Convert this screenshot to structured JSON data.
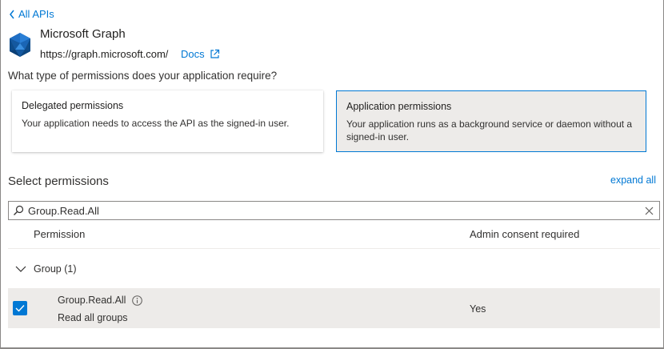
{
  "nav": {
    "back_label": "All APIs"
  },
  "api": {
    "name": "Microsoft Graph",
    "url": "https://graph.microsoft.com/",
    "docs_label": "Docs",
    "logo_icon": "microsoft-graph-logo",
    "brand_color": "#0078d4"
  },
  "question": "What type of permissions does your application require?",
  "permission_types": [
    {
      "title": "Delegated permissions",
      "description": "Your application needs to access the API as the signed-in user.",
      "selected": false
    },
    {
      "title": "Application permissions",
      "description": "Your application runs as a background service or daemon without a signed-in user.",
      "selected": true
    }
  ],
  "select": {
    "heading": "Select permissions",
    "expand_all_label": "expand all",
    "search_value": "Group.Read.All",
    "search_icon": "search-icon",
    "clear_icon": "close-icon"
  },
  "table": {
    "columns": [
      "Permission",
      "Admin consent required"
    ],
    "groups": [
      {
        "label": "Group (1)",
        "expanded": true,
        "items": [
          {
            "name": "Group.Read.All",
            "description": "Read all groups",
            "admin_consent": "Yes",
            "checked": true
          }
        ]
      }
    ]
  },
  "colors": {
    "accent": "#0078d4",
    "selected_card_bg": "#edebe9",
    "row_bg": "#edebe9"
  }
}
